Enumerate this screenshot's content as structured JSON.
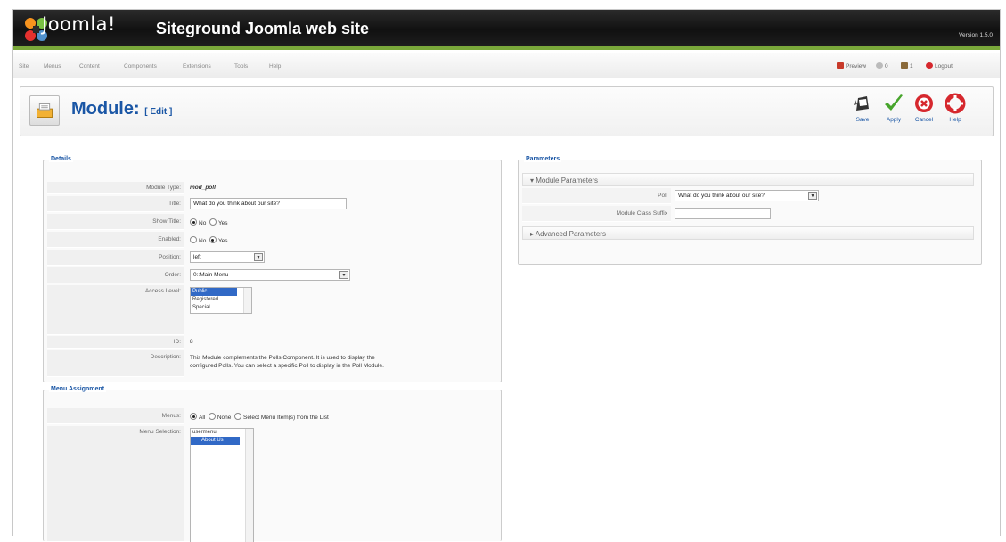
{
  "header": {
    "logo_text": "Joomla!",
    "site_title": "Siteground Joomla web site",
    "version": "Version 1.5.0"
  },
  "menu": {
    "items": [
      "Site",
      "Menus",
      "Content",
      "Components",
      "Extensions",
      "Tools",
      "Help"
    ]
  },
  "status": {
    "preview": "Preview",
    "messages": "0",
    "users": "1",
    "logout": "Logout"
  },
  "toolbar": {
    "title": "Module:",
    "subtitle": "[ Edit ]",
    "buttons": [
      "Save",
      "Apply",
      "Cancel",
      "Help"
    ]
  },
  "details": {
    "legend": "Details",
    "labels": {
      "module_type": "Module Type:",
      "title": "Title:",
      "show_title": "Show Title:",
      "enabled": "Enabled:",
      "position": "Position:",
      "order": "Order:",
      "access_level": "Access Level:",
      "id": "ID:",
      "description": "Description:"
    },
    "module_type": "mod_poll",
    "title_value": "What do you think about our site?",
    "show_title_options": [
      "No",
      "Yes"
    ],
    "show_title_selected": "No",
    "enabled_options": [
      "No",
      "Yes"
    ],
    "enabled_selected": "Yes",
    "position_value": "left",
    "order_value": "0::Main Menu",
    "access_options": [
      "Public",
      "Registered",
      "Special"
    ],
    "access_selected": "Public",
    "id_value": "8",
    "description_line1": "This Module complements the Polls Component. It is used to display the",
    "description_line2": "configured Polls. You can select a specific Poll to display in the Poll Module."
  },
  "menu_assignment": {
    "legend": "Menu Assignment",
    "menus_label": "Menus:",
    "menus_options": [
      "All",
      "None",
      "Select Menu Item(s) from the List"
    ],
    "menus_selected": "All",
    "selection_label": "Menu Selection:",
    "selection_items": [
      "usermenu",
      "About Us"
    ]
  },
  "parameters": {
    "legend": "Parameters",
    "module_params_title": "Module Parameters",
    "poll_label": "Poll",
    "poll_value": "What do you think about our site?",
    "suffix_label": "Module Class Suffix",
    "suffix_value": "",
    "advanced_title": "Advanced Parameters"
  },
  "colors": {
    "accent": "#1a56a5",
    "header_bg": "#111111",
    "green_bar": "#7aa83a"
  }
}
